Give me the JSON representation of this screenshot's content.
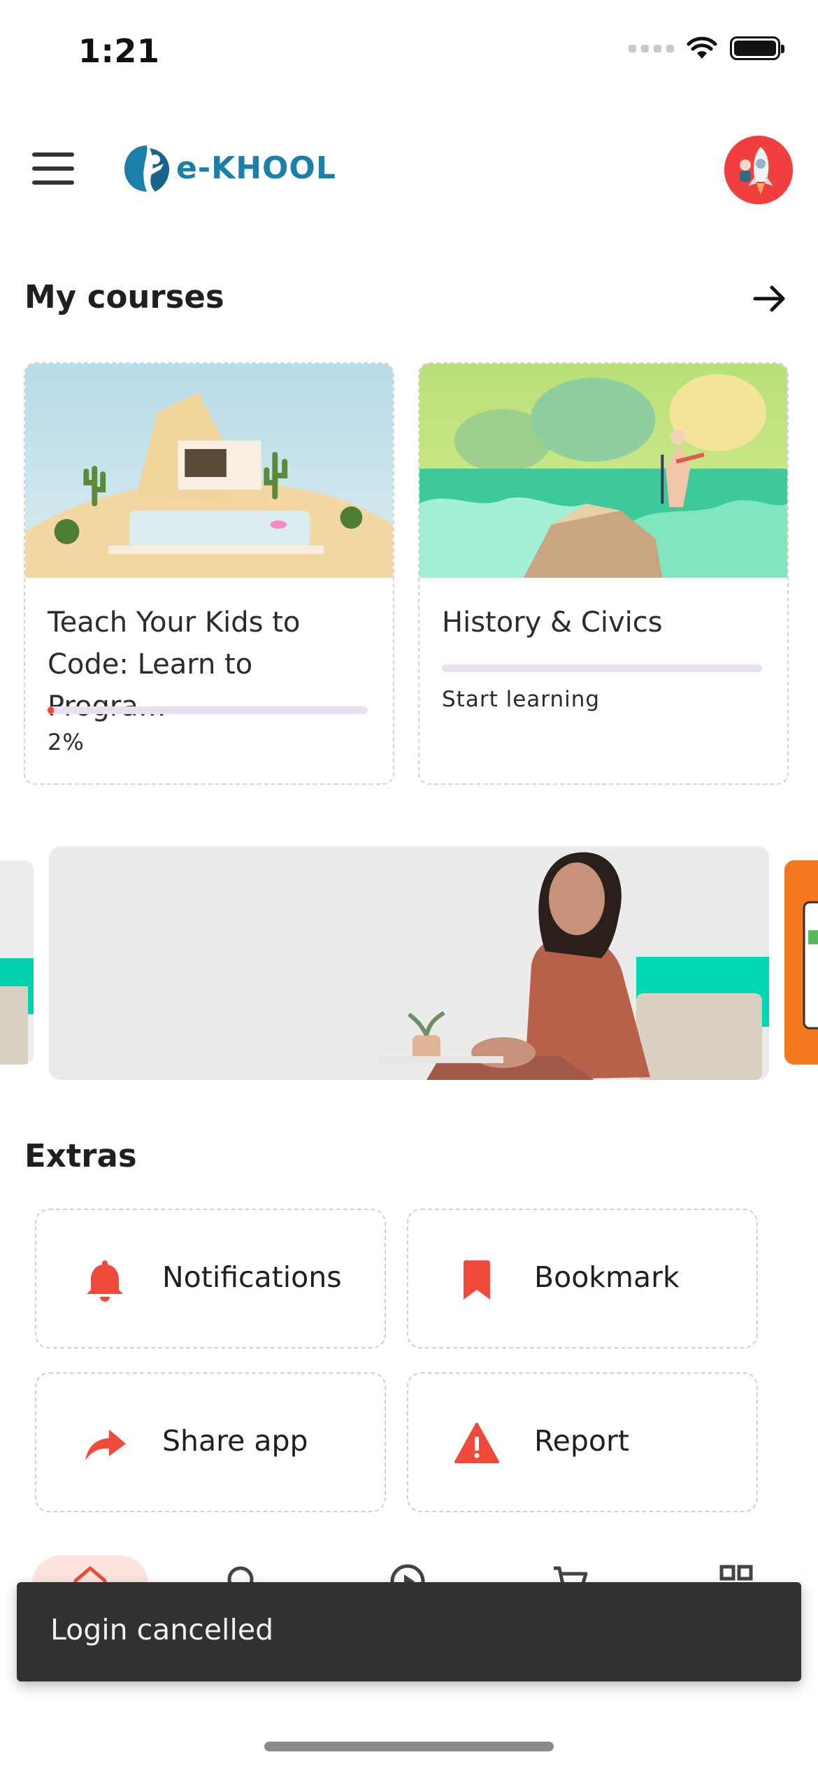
{
  "status_bar": {
    "time": "1:21"
  },
  "header": {
    "logo_text": "e-KHOOL"
  },
  "my_courses": {
    "title": "My courses",
    "courses": [
      {
        "title": "Teach Your Kids to Code: Learn to Progra…",
        "progress_label": "2%",
        "progress": 0.02
      },
      {
        "title": "History & Civics",
        "progress_label": "Start learning",
        "progress": 0
      }
    ]
  },
  "extras": {
    "title": "Extras",
    "items": [
      {
        "label": "Notifications",
        "icon": "bell-icon"
      },
      {
        "label": "Bookmark",
        "icon": "bookmark-icon"
      },
      {
        "label": "Share app",
        "icon": "share-icon"
      },
      {
        "label": "Report",
        "icon": "warning-icon"
      }
    ]
  },
  "bottom_nav": {
    "items": [
      "home-icon",
      "search-icon",
      "play-icon",
      "cart-icon",
      "grid-icon"
    ],
    "active": "home-icon"
  },
  "snackbar": {
    "text": "Login cancelled"
  },
  "colors": {
    "accent": "#f04a3c",
    "brand": "#1a7fab",
    "snackbar": "#313033",
    "progress_track": "#e6e0ef"
  }
}
